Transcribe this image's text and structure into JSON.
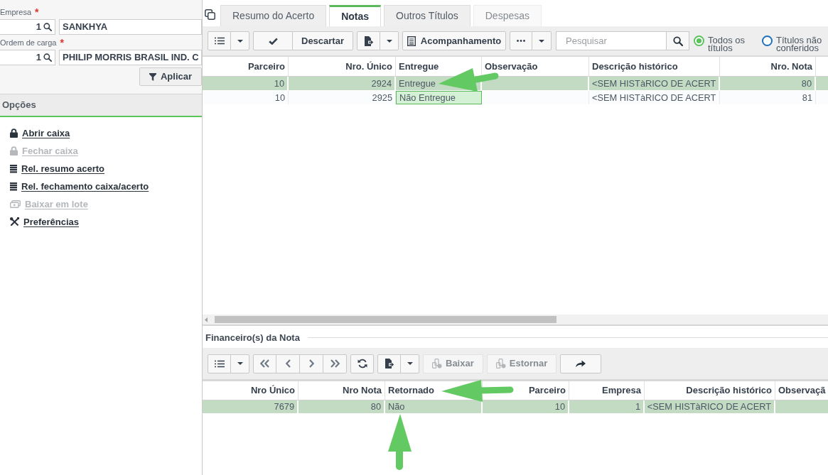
{
  "sidebar": {
    "fields": [
      {
        "label": "Empresa",
        "required_mark": "*",
        "code": "1",
        "description": "SANKHYA"
      },
      {
        "label": "Ordem de carga",
        "required_mark": "*",
        "code": "1",
        "description": "PHILIP MORRIS BRASIL IND. C"
      }
    ],
    "apply_button": {
      "label": "Aplicar"
    },
    "options_title": "Opções",
    "options": [
      {
        "label": "Abrir caixa",
        "kind": "lock",
        "disabled": false
      },
      {
        "label": "Fechar caixa",
        "kind": "lock",
        "disabled": true
      },
      {
        "label": "Rel. resumo acerto",
        "kind": "report",
        "disabled": false
      },
      {
        "label": "Rel. fechamento caixa/acerto",
        "kind": "report",
        "disabled": false
      },
      {
        "label": "Baixar em lote",
        "kind": "money",
        "disabled": true
      },
      {
        "label": "Preferências",
        "kind": "tools",
        "disabled": false
      }
    ]
  },
  "tabs": [
    {
      "label": "Resumo do Acerto",
      "selected": false,
      "disabled": false
    },
    {
      "label": "Notas",
      "selected": true,
      "disabled": false
    },
    {
      "label": "Outros Títulos",
      "selected": false,
      "disabled": false
    },
    {
      "label": "Despesas",
      "selected": false,
      "disabled": true
    }
  ],
  "notes_toolbar": {
    "buttons": [
      {
        "label": "Descartar"
      },
      {
        "label": "Acompanhamento"
      }
    ],
    "search": {
      "placeholder": "Pesquisar"
    },
    "filter_options": [
      {
        "label": "Todos os títulos",
        "selected": true
      },
      {
        "label": "Títulos não conferidos",
        "selected": false
      }
    ]
  },
  "notes_table": {
    "columns": [
      {
        "label": "Parceiro",
        "right_aligned": true
      },
      {
        "label": "Nro. Único",
        "right_aligned": true
      },
      {
        "label": "Entregue",
        "right_aligned": false
      },
      {
        "label": "Observação",
        "right_aligned": false
      },
      {
        "label": "Descrição histórico",
        "right_aligned": false
      },
      {
        "label": "Nro. Nota",
        "right_aligned": true
      }
    ],
    "rows": [
      {
        "selected": true,
        "cells": [
          {
            "text": "10",
            "editing": false
          },
          {
            "text": "2924",
            "editing": false
          },
          {
            "text": "Entregue",
            "editing": false
          },
          {
            "editing": false
          },
          {
            "text": "<SEM HISTàRICO DE ACERT",
            "editing": false
          },
          {
            "text": "80",
            "editing": false
          }
        ]
      },
      {
        "selected": false,
        "cells": [
          {
            "text": "10",
            "editing": false
          },
          {
            "text": "2925",
            "editing": false
          },
          {
            "text": "Não Entregue",
            "editing": true
          },
          {
            "editing": false
          },
          {
            "text": "<SEM HISTàRICO DE ACERT",
            "editing": false
          },
          {
            "text": "81",
            "editing": false
          }
        ]
      }
    ]
  },
  "financial_section": {
    "title": "Financeiro(s) da Nota",
    "toolbar": {
      "buttons": [
        {
          "label": "Baixar",
          "disabled": true
        },
        {
          "label": "Estornar",
          "disabled": true
        }
      ]
    },
    "table": {
      "columns": [
        {
          "label": "Nro Único",
          "right_aligned": true
        },
        {
          "label": "Nro Nota",
          "right_aligned": true
        },
        {
          "label": "Retornado",
          "right_aligned": false
        },
        {
          "label": "Parceiro",
          "right_aligned": true
        },
        {
          "label": "Empresa",
          "right_aligned": true
        },
        {
          "label": "Descrição histórico",
          "right_aligned": true
        },
        {
          "label": "Observaçã",
          "right_aligned": false
        }
      ],
      "rows": [
        {
          "selected": true,
          "cells": [
            "7679",
            "80",
            "Não",
            "10",
            "1",
            "<SEM HISTàRICO DE ACERT"
          ]
        }
      ]
    }
  }
}
